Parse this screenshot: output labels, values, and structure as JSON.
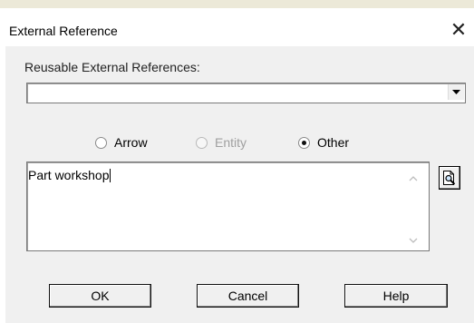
{
  "window": {
    "title": "External Reference",
    "close_glyph": "✕"
  },
  "references": {
    "label": "Reusable External References:",
    "selected_value": ""
  },
  "reference_type": {
    "options": [
      {
        "label": "Arrow",
        "checked": false,
        "enabled": true
      },
      {
        "label": "Entity",
        "checked": false,
        "enabled": false
      },
      {
        "label": "Other",
        "checked": true,
        "enabled": true
      }
    ]
  },
  "text_field": {
    "value": "Part workshop"
  },
  "buttons": {
    "ok": "OK",
    "cancel": "Cancel",
    "help": "Help"
  },
  "icons": {
    "combo_arrow": "chevron-down-icon",
    "browse": "document-magnifier-icon",
    "scroll_up": "chevron-up-icon",
    "scroll_down": "chevron-down-icon"
  },
  "colors": {
    "dialog_bg": "#f0f0f0",
    "titlebar_bg": "#ffffff",
    "disabled_text": "#a0a0a0"
  }
}
